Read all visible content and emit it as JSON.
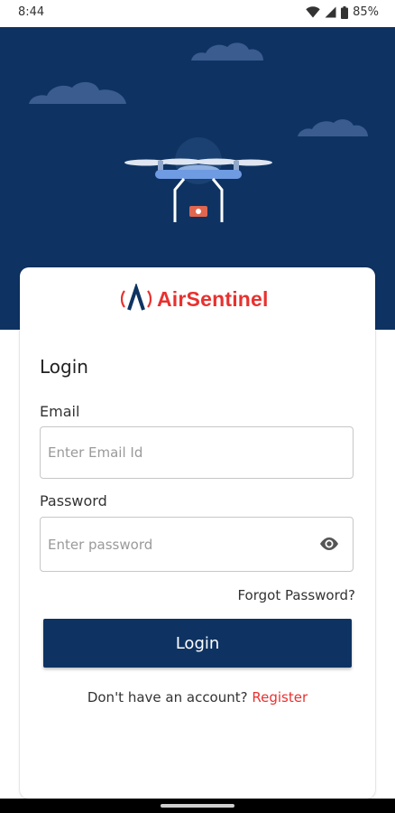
{
  "status_bar": {
    "time": "8:44",
    "battery": "85%",
    "icons": [
      "wifi-icon",
      "cellular-signal-icon",
      "battery-icon"
    ]
  },
  "hero": {
    "illustration": "drone",
    "background_color": "#0e3362",
    "cloud_color": "#3a5c8f"
  },
  "brand": {
    "name": "AirSentinel",
    "logo": "airsentinel-logo-icon",
    "color": "#e8312f"
  },
  "login_form": {
    "heading": "Login",
    "email_label": "Email",
    "email_placeholder": "Enter Email Id",
    "email_value": "",
    "password_label": "Password",
    "password_placeholder": "Enter password",
    "password_value": "",
    "password_toggle_icon": "eye-icon",
    "forgot_password": "Forgot Password?",
    "submit_label": "Login",
    "register_prompt": "Don't have an account?",
    "register_link": "Register",
    "button_color": "#0e3362",
    "link_color": "#e8312f"
  }
}
